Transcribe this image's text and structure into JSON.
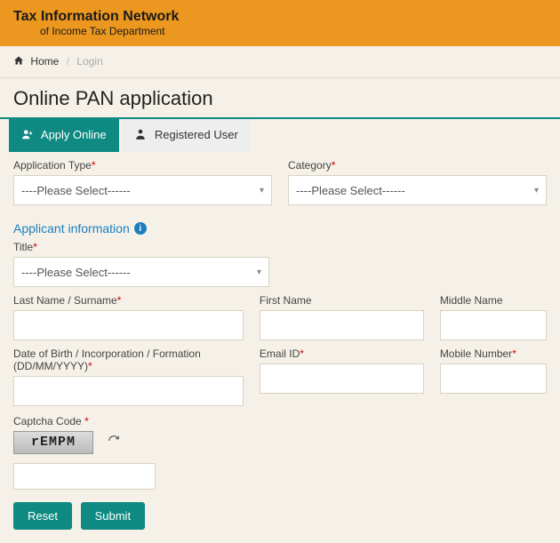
{
  "brand": {
    "main": "Tax Information Network",
    "sub": "of Income Tax Department"
  },
  "breadcrumb": {
    "home": "Home",
    "current": "Login"
  },
  "page_title": "Online PAN application",
  "tabs": {
    "apply": "Apply Online",
    "registered": "Registered User"
  },
  "form": {
    "app_type_label": "Application Type",
    "app_type_value": "----Please Select------",
    "category_label": "Category",
    "category_value": "----Please Select------",
    "section_applicant": "Applicant information",
    "title_label": "Title",
    "title_value": "----Please Select------",
    "last_name_label": "Last Name / Surname",
    "first_name_label": "First Name",
    "middle_name_label": "Middle Name",
    "dob_label": "Date of Birth / Incorporation / Formation (DD/MM/YYYY)",
    "email_label": "Email ID",
    "mobile_label": "Mobile Number",
    "captcha_label": "Captcha Code",
    "captcha_text": "rEMPM"
  },
  "buttons": {
    "reset": "Reset",
    "submit": "Submit"
  }
}
